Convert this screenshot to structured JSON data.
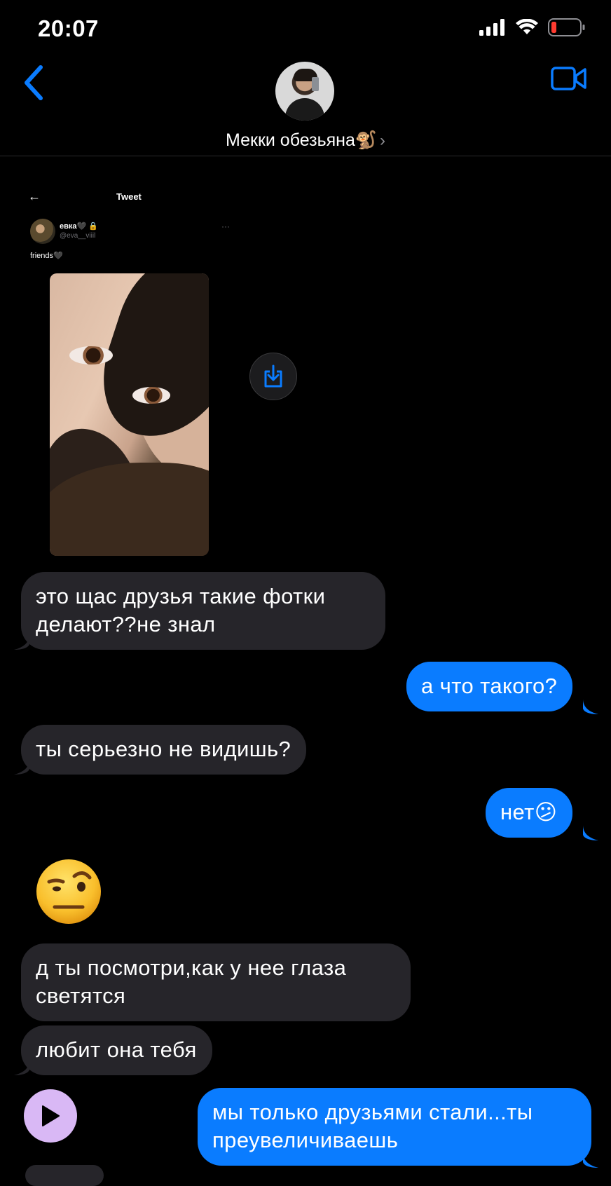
{
  "status_bar": {
    "time": "20:07",
    "icons": [
      "signal-icon",
      "wifi-icon",
      "battery-low-icon"
    ]
  },
  "header": {
    "contact_name": "Мекки обезьяна🐒",
    "chevron": "›",
    "icons": [
      "back-chevron-icon",
      "video-call-icon"
    ]
  },
  "tweet": {
    "back_arrow": "←",
    "title": "Tweet",
    "username": "евка🖤 🔒",
    "handle": "@eva__viiil",
    "more": "···",
    "text": "friends🖤"
  },
  "messages": [
    {
      "dir": "in",
      "text": "это щас друзья такие фотки делают??не знал"
    },
    {
      "dir": "out",
      "text": "а что такого?"
    },
    {
      "dir": "in",
      "text": "ты серьезно не видишь?"
    },
    {
      "dir": "out",
      "text": "нет😕"
    },
    {
      "dir": "in",
      "text": "🤨",
      "kind": "big-emoji"
    },
    {
      "dir": "in",
      "text": "д ты посмотри,как у нее глаза светятся"
    },
    {
      "dir": "in",
      "text": "любит она тебя"
    },
    {
      "dir": "out",
      "text": "мы только друзьями стали...ты преувеличиваешь"
    }
  ],
  "colors": {
    "background": "#000000",
    "incoming_bubble": "#26252a",
    "outgoing_bubble": "#0a7cff",
    "accent": "#0a7cff",
    "play_button": "#d9b8f5"
  }
}
